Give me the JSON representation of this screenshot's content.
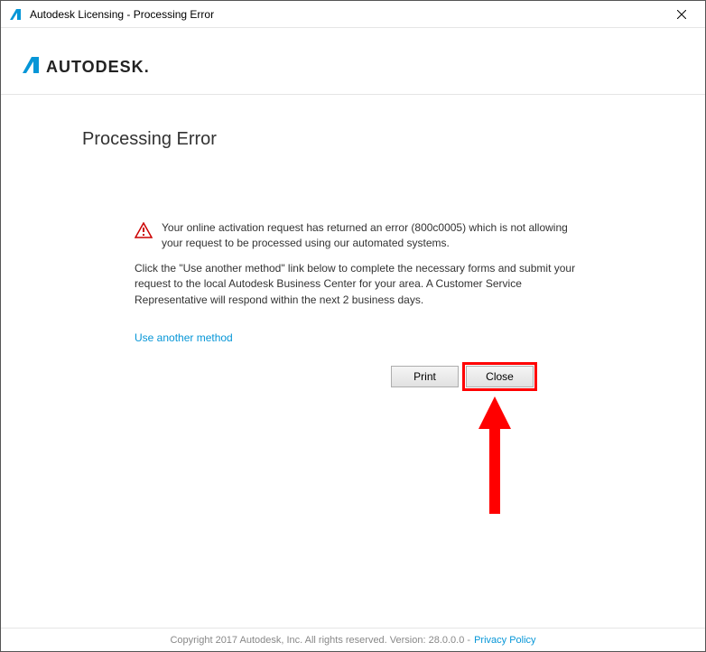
{
  "titlebar": {
    "title": "Autodesk Licensing - Processing Error"
  },
  "brand": {
    "name": "AUTODESK"
  },
  "page": {
    "title": "Processing Error"
  },
  "message": {
    "primary": "Your online activation request has returned an error (800c0005) which is not allowing your request to be processed using our automated systems.",
    "secondary": "Click the \"Use another method\" link below to complete the necessary forms and submit your request to the local Autodesk Business Center for your area. A Customer Service Representative will respond within the next 2 business days.",
    "link": "Use another method"
  },
  "buttons": {
    "print": "Print",
    "close": "Close"
  },
  "footer": {
    "copyright": "Copyright 2017 Autodesk, Inc. All rights reserved. Version: 28.0.0.0 -",
    "privacy": "Privacy Policy"
  }
}
